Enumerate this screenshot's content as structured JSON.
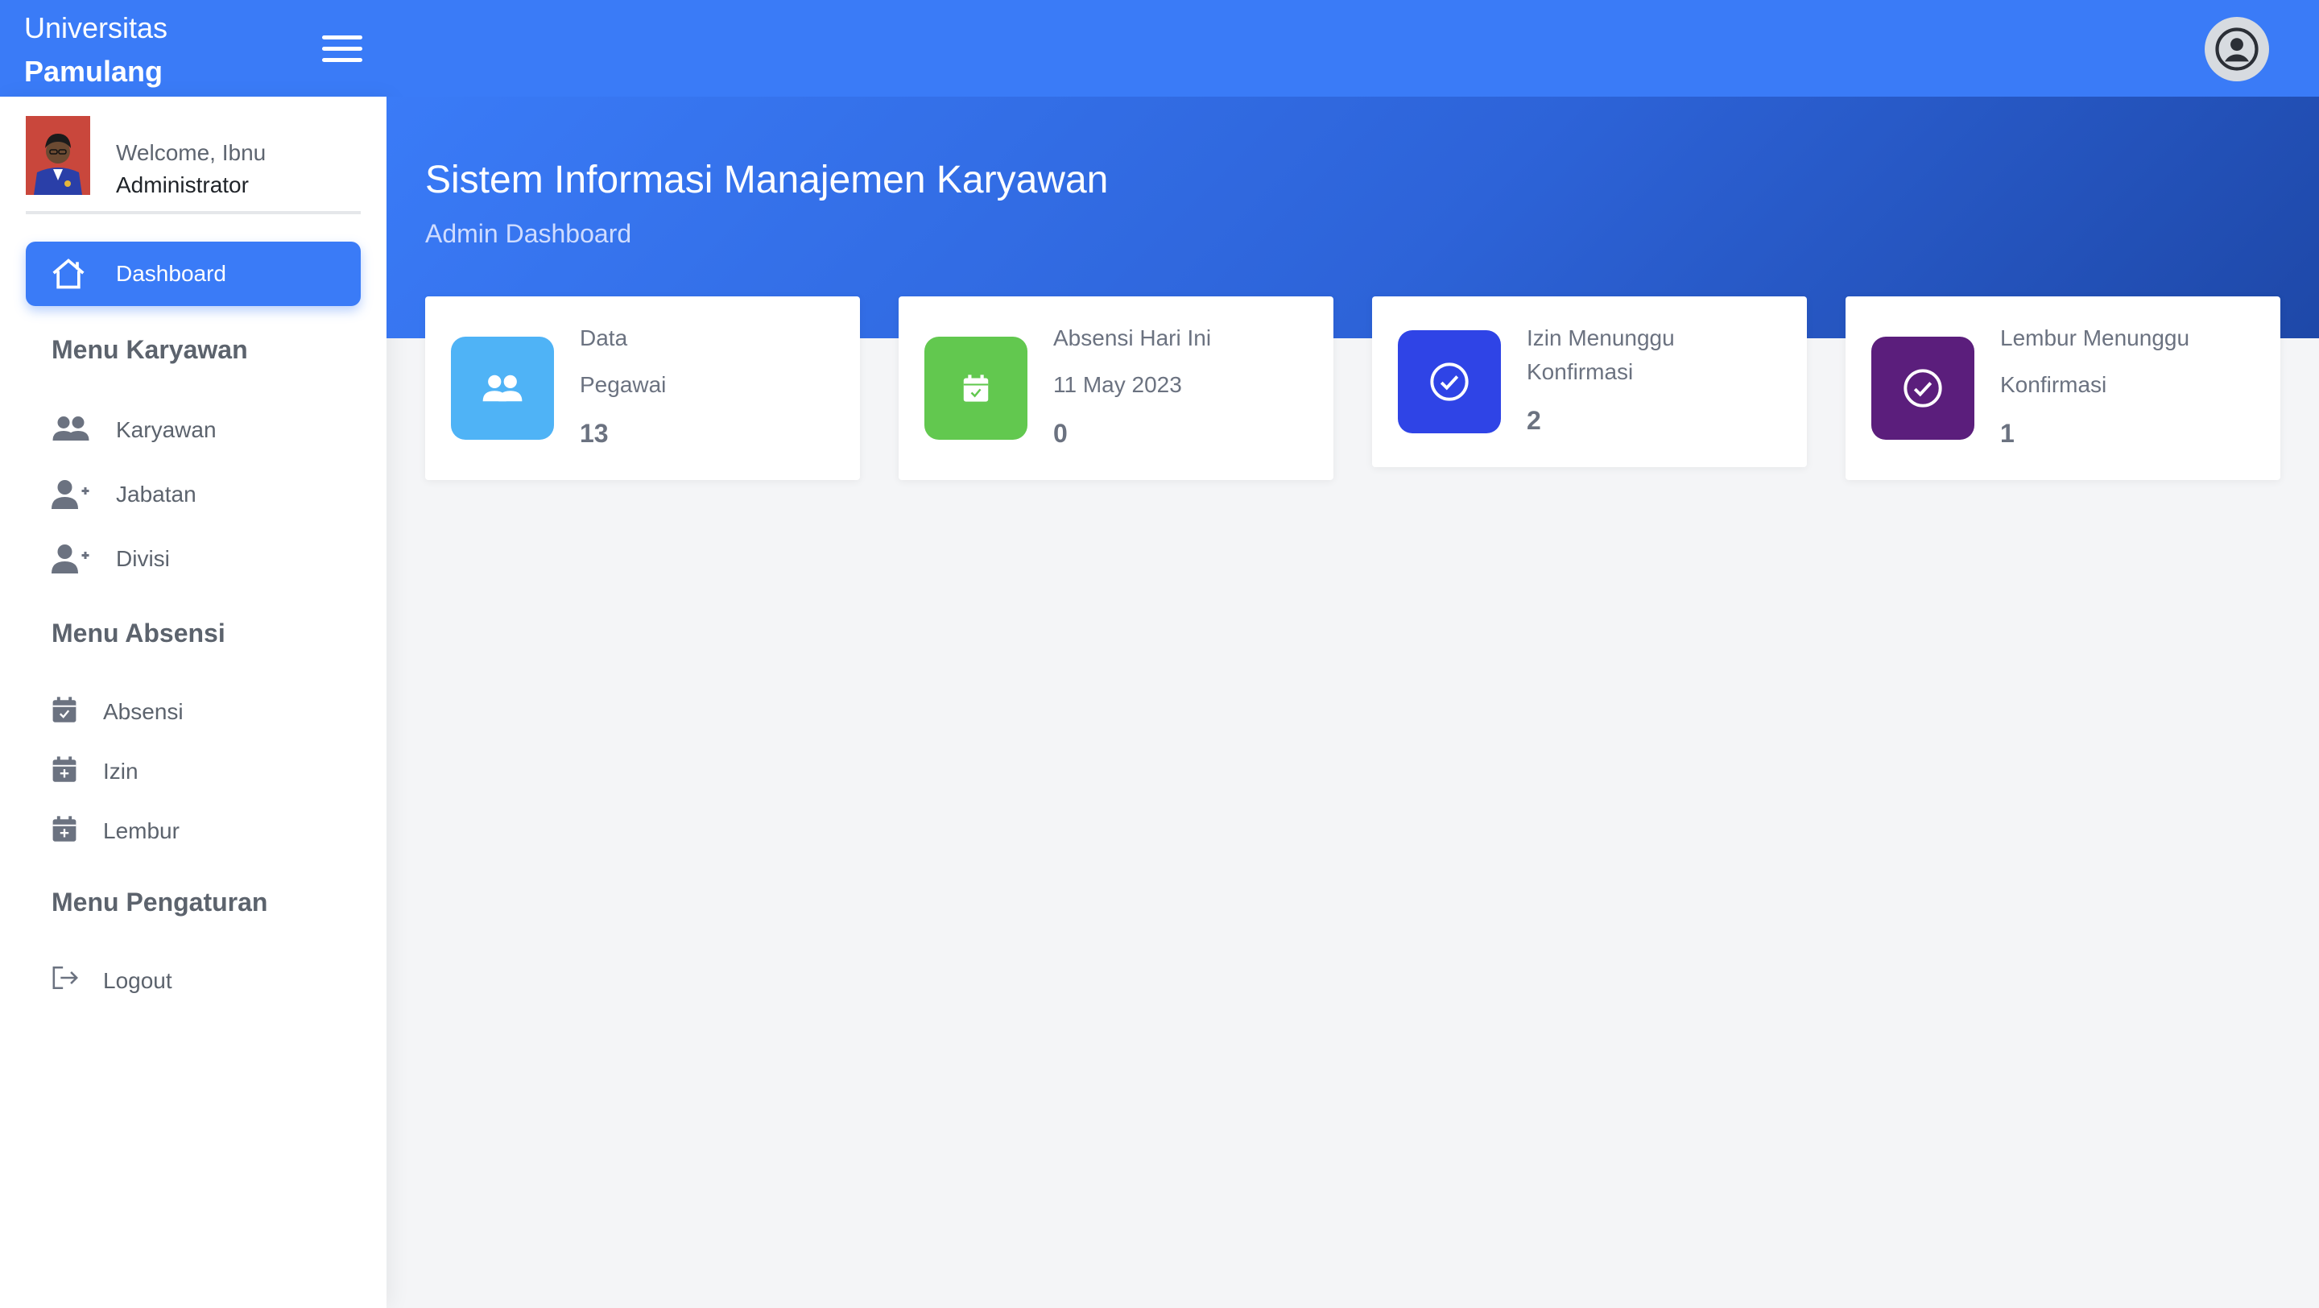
{
  "brand": {
    "line1": "Universitas",
    "line2": "Pamulang"
  },
  "sidebar": {
    "welcome": "Welcome, Ibnu",
    "role": "Administrator",
    "active_item": {
      "label": "Dashboard",
      "icon": "home-icon"
    },
    "sections": [
      {
        "title": "Menu Karyawan",
        "items": [
          {
            "label": "Karyawan",
            "icon": "users-icon"
          },
          {
            "label": "Jabatan",
            "icon": "user-plus-icon"
          },
          {
            "label": "Divisi",
            "icon": "user-plus-icon"
          }
        ]
      },
      {
        "title": "Menu Absensi",
        "items": [
          {
            "label": "Absensi",
            "icon": "calendar-check-icon"
          },
          {
            "label": "Izin",
            "icon": "calendar-plus-icon"
          },
          {
            "label": "Lembur",
            "icon": "calendar-plus-icon"
          }
        ]
      },
      {
        "title": "Menu Pengaturan",
        "items": [
          {
            "label": "Logout",
            "icon": "logout-icon"
          }
        ]
      }
    ]
  },
  "header": {
    "title": "Sistem Informasi Manajemen Karyawan",
    "subtitle": "Admin Dashboard"
  },
  "cards": [
    {
      "line1": "Data",
      "line2": "Pegawai",
      "value": "13",
      "icon": "users-icon",
      "color": "#4fb3f6"
    },
    {
      "line1": "Absensi Hari Ini",
      "line2": "11 May 2023",
      "value": "0",
      "icon": "calendar-check-icon",
      "color": "#62c84f"
    },
    {
      "line1": "Izin Menunggu",
      "line2": "Konfirmasi",
      "value": "2",
      "icon": "check-circle-icon",
      "color": "#2f44e6"
    },
    {
      "line1": "Lembur Menunggu",
      "line2": "Konfirmasi",
      "value": "1",
      "icon": "check-circle-icon",
      "color": "#5b1e7c"
    }
  ],
  "colors": {
    "primary": "#3a7bf7",
    "sidebar_text": "#5c636d"
  }
}
